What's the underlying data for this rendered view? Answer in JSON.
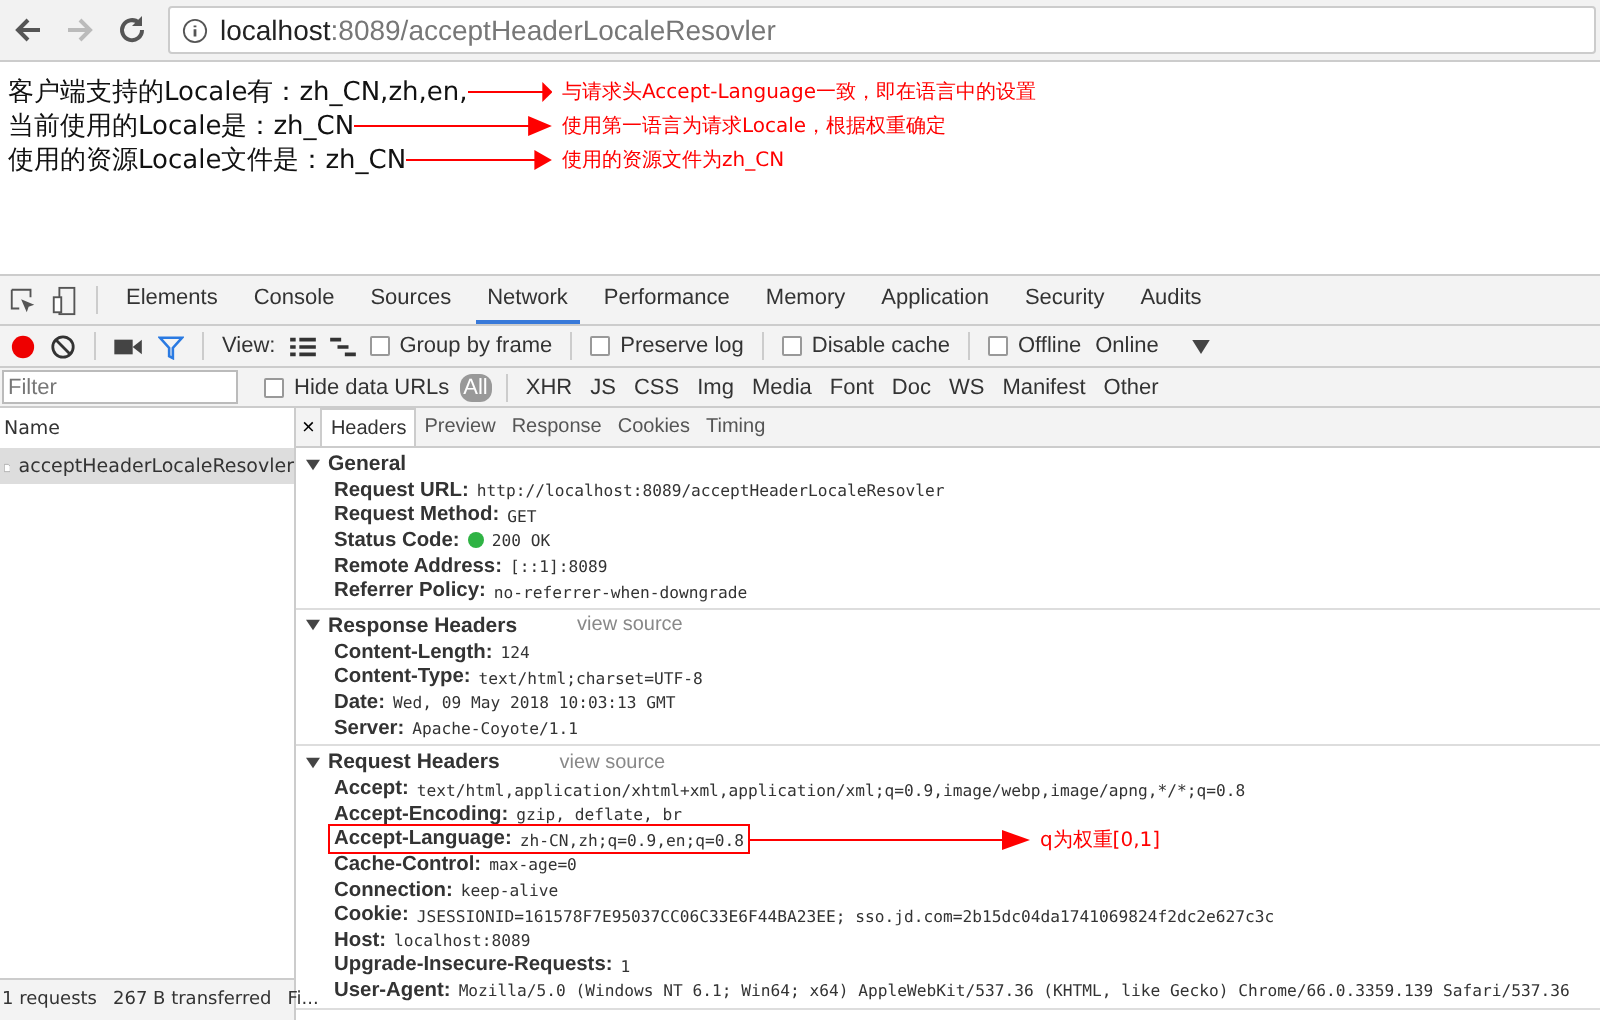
{
  "browser": {
    "url_host": "localhost",
    "url_path": ":8089/acceptHeaderLocaleResovler"
  },
  "page": {
    "lines": [
      {
        "text": "客户端支持的Locale有：zh_CN,zh,en,",
        "note": "与请求头Accept-Language一致，即在语言中的设置"
      },
      {
        "text": "当前使用的Locale是：zh_CN",
        "note": "使用第一语言为请求Locale，根据权重确定"
      },
      {
        "text": "使用的资源Locale文件是：zh_CN",
        "note": "使用的资源文件为zh_CN"
      }
    ]
  },
  "devtools": {
    "tabs": [
      {
        "label": "Elements",
        "selected": false
      },
      {
        "label": "Console",
        "selected": false
      },
      {
        "label": "Sources",
        "selected": false
      },
      {
        "label": "Network",
        "selected": true
      },
      {
        "label": "Performance",
        "selected": false
      },
      {
        "label": "Memory",
        "selected": false
      },
      {
        "label": "Application",
        "selected": false
      },
      {
        "label": "Security",
        "selected": false
      },
      {
        "label": "Audits",
        "selected": false
      }
    ],
    "toolbar": {
      "recording": true,
      "view_label": "View:",
      "options": [
        {
          "label": "Group by frame",
          "checked": false
        },
        {
          "label": "Preserve log",
          "checked": false
        },
        {
          "label": "Disable cache",
          "checked": false
        },
        {
          "label": "Offline",
          "checked": false
        }
      ],
      "throttling": "Online"
    },
    "filter": {
      "placeholder": "Filter",
      "hide_data_urls": {
        "label": "Hide data URLs",
        "checked": false
      },
      "types": [
        {
          "label": "All",
          "selected": true
        },
        {
          "label": "XHR",
          "selected": false
        },
        {
          "label": "JS",
          "selected": false
        },
        {
          "label": "CSS",
          "selected": false
        },
        {
          "label": "Img",
          "selected": false
        },
        {
          "label": "Media",
          "selected": false
        },
        {
          "label": "Font",
          "selected": false
        },
        {
          "label": "Doc",
          "selected": false
        },
        {
          "label": "WS",
          "selected": false
        },
        {
          "label": "Manifest",
          "selected": false
        },
        {
          "label": "Other",
          "selected": false
        }
      ]
    },
    "requests": {
      "column": "Name",
      "items": [
        {
          "name": "acceptHeaderLocaleResovler",
          "selected": true
        }
      ],
      "summary": [
        "1 requests",
        "267 B transferred",
        "Fi..."
      ]
    },
    "detail": {
      "close": "×",
      "tabs": [
        {
          "label": "Headers",
          "selected": true
        },
        {
          "label": "Preview",
          "selected": false
        },
        {
          "label": "Response",
          "selected": false
        },
        {
          "label": "Cookies",
          "selected": false
        },
        {
          "label": "Timing",
          "selected": false
        }
      ],
      "sections": [
        {
          "title": "General",
          "expanded": true,
          "rows": [
            {
              "key": "Request URL:",
              "value": "http://localhost:8089/acceptHeaderLocaleResovler"
            },
            {
              "key": "Request Method:",
              "value": "GET"
            },
            {
              "key": "Status Code:",
              "value": "200 OK",
              "color": "#2fb344"
            },
            {
              "key": "Remote Address:",
              "value": "[::1]:8089"
            },
            {
              "key": "Referrer Policy:",
              "value": "no-referrer-when-downgrade"
            }
          ]
        },
        {
          "title": "Response Headers",
          "expanded": true,
          "view_source": "view source",
          "rows": [
            {
              "key": "Content-Length:",
              "value": "124"
            },
            {
              "key": "Content-Type:",
              "value": "text/html;charset=UTF-8"
            },
            {
              "key": "Date:",
              "value": "Wed, 09 May 2018 10:03:13 GMT"
            },
            {
              "key": "Server:",
              "value": "Apache-Coyote/1.1"
            }
          ]
        },
        {
          "title": "Request Headers",
          "expanded": true,
          "view_source": "view source",
          "rows": [
            {
              "key": "Accept:",
              "value": "text/html,application/xhtml+xml,application/xml;q=0.9,image/webp,image/apng,*/*;q=0.8"
            },
            {
              "key": "Accept-Encoding:",
              "value": "gzip, deflate, br"
            },
            {
              "key": "Accept-Language:",
              "value": "zh-CN,zh;q=0.9,en;q=0.8",
              "note": "q为权重[0,1]"
            },
            {
              "key": "Cache-Control:",
              "value": "max-age=0"
            },
            {
              "key": "Connection:",
              "value": "keep-alive"
            },
            {
              "key": "Cookie:",
              "value": "JSESSIONID=161578F7E95037CC06C33E6F44BA23EE; sso.jd.com=2b15dc04da1741069824f2dc2e627c3c"
            },
            {
              "key": "Host:",
              "value": "localhost:8089"
            },
            {
              "key": "Upgrade-Insecure-Requests:",
              "value": "1"
            },
            {
              "key": "User-Agent:",
              "value": "Mozilla/5.0 (Windows NT 6.1; Win64; x64) AppleWebKit/537.36 (KHTML, like Gecko) Chrome/66.0.3359.139 Safari/537.36"
            }
          ]
        }
      ]
    }
  }
}
